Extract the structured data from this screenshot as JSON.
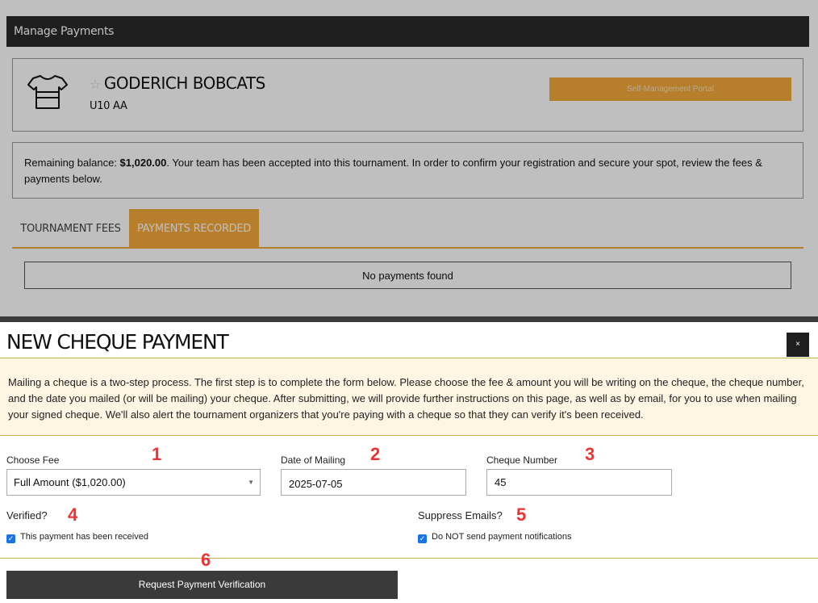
{
  "header": {
    "title": "Manage Payments"
  },
  "team": {
    "name": "GODERICH BOBCATS",
    "division": "U10 AA",
    "portal_button": "Self-Management Portal"
  },
  "balance": {
    "prefix": "Remaining balance: ",
    "amount": "$1,020.00",
    "message": ". Your team has been accepted into this tournament. In order to confirm your registration and secure your spot, review the fees & payments below."
  },
  "tabs": [
    {
      "label": "TOURNAMENT FEES"
    },
    {
      "label": "PAYMENTS RECORDED",
      "active": true
    }
  ],
  "payments": {
    "empty_text": "No payments found"
  },
  "modal": {
    "title": "NEW CHEQUE PAYMENT",
    "close_label": "×",
    "notice": "Mailing a cheque is a two-step process. The first step is to complete the form below. Please choose the fee & amount you will be writing on the cheque, the cheque number, and the date you mailed (or will be mailing) your cheque. After submitting, we will provide further instructions on this page, as well as by email, for you to use when mailing your signed cheque. We'll also alert the tournament organizers that you're paying with a cheque so that they can verify it's been received.",
    "fee": {
      "label": "Choose Fee",
      "value": "Full Amount ($1,020.00)"
    },
    "mailing_date": {
      "label": "Date of Mailing",
      "value": "2025-07-05"
    },
    "cheque_number": {
      "label": "Cheque Number",
      "value": "45"
    },
    "verified": {
      "label": "Verified?",
      "checkbox_label": "This payment has been received",
      "checked": true
    },
    "suppress": {
      "label": "Suppress Emails?",
      "checkbox_label": "Do NOT send payment notifications",
      "checked": true
    },
    "submit_label": "Request Payment Verification"
  },
  "markers": [
    "1",
    "2",
    "3",
    "4",
    "5",
    "6"
  ],
  "colors": {
    "accent": "#f5a83a",
    "dark": "#2a2a2a",
    "marker": "#ee3333",
    "checkbox": "#1a73e8"
  }
}
